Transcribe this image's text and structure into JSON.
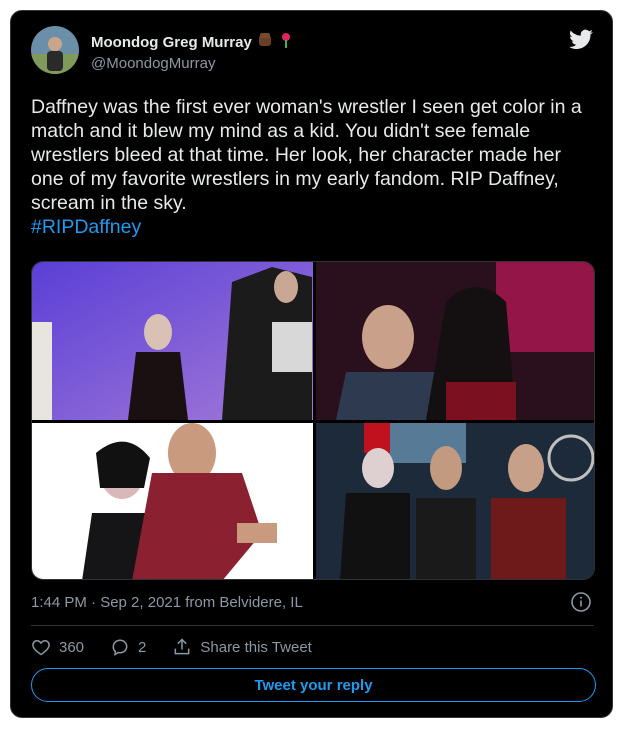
{
  "author": {
    "display_name": "Moondog Greg Murray",
    "handle": "@MoondogMurray",
    "emoji_icons": [
      "raised-fist-icon",
      "rose-icon"
    ]
  },
  "tweet": {
    "text": "Daffney was the first ever woman's wrestler I seen get color in a match and it blew my mind as a kid. You didn't see female wrestlers bleed at that time. Her look, her character made her one of my favorite wrestlers in my early fandom. RIP Daffney, scream in the sky.",
    "hashtag": "#RIPDaffney"
  },
  "meta": {
    "timestamp": "1:44 PM · Sep 2, 2021 from Belvidere, IL"
  },
  "actions": {
    "likes": "360",
    "replies": "2",
    "share_label": "Share this Tweet"
  },
  "reply_button": "Tweet your reply",
  "colors": {
    "background": "#000000",
    "text": "#e7e9ea",
    "muted": "#8b98a5",
    "accent": "#1d9bf0"
  }
}
